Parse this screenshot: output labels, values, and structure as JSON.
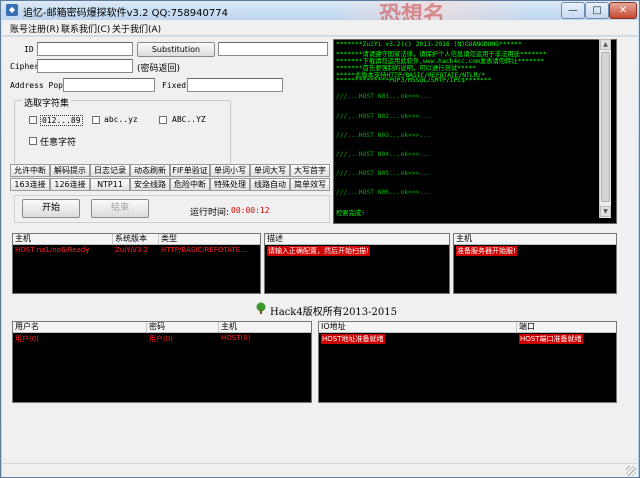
{
  "window": {
    "title": "追忆-邮箱密码爆探软件v3.2  QQ:758940774",
    "deco_text": "恐想名"
  },
  "menu": [
    "账号注册(R)",
    "联系我们(C)",
    "关于我们(A)"
  ],
  "form": {
    "id_label": "ID",
    "id_value": "",
    "substitution_button": "Substitution",
    "substitution_value": "",
    "cipher_label": "Cipher",
    "cipher_value": "",
    "cipher_note": "(密码返回)",
    "address_label": "Address Pop3",
    "address_value": "",
    "fixed_label": "Fixed",
    "fixed_value": ""
  },
  "charset": {
    "legend": "选取字符集",
    "options": [
      {
        "label": "012...89",
        "checked": false
      },
      {
        "label": "abc..yz",
        "checked": false
      },
      {
        "label": "ABC..YZ",
        "checked": false
      },
      {
        "label": "任意字符",
        "checked": false
      }
    ]
  },
  "tools_row1": [
    "允许中断",
    "解码提示",
    "日志记录",
    "动态刷新",
    "FIF单验证",
    "单词小写",
    "单词大写",
    "大写首字"
  ],
  "tools_row2": [
    "163连接",
    "126连接",
    "NTP11",
    "安全线路",
    "危险中断",
    "特殊处理",
    "线路自动",
    "简单效写"
  ],
  "run": {
    "start_button": "开始",
    "stop_button": "结束",
    "time_label": "运行时间:",
    "time_value": "00:00:12"
  },
  "console": {
    "lines": [
      "*******ZuiYi v3.2(c) 2013-2016 (N)GUANGDONG******",
      "*******请请遵守国家法律，请保护个人信息请勿运用于非法用途*******",
      "*******下载请勿运用此软件,www.hack4cc.com发表请勿转让*******",
      "*******首先要强制的说明，可以进行测试*****",
      "*****此版本支持HTTP/BASIC/REFOTATE/NTLM/*",
      "**************POP3/MSSQL/SMTP/IPC$*******",
      "///...HOST N01...ok>>>...",
      "///...HOST N02...ok>>>...",
      "///...HOST N03...ok>>>...",
      "///...HOST N04...ok>>>...",
      "///...HOST N05...ok>>>...",
      "///...HOST N06...ok>>>...",
      "检索完成!"
    ]
  },
  "result_panel": {
    "headers": [
      "主机",
      "系统版本",
      "类型"
    ],
    "row": [
      "HOST no1/no6/Ready",
      "ZuiYiV3.2",
      "HTTP/BASIC/REFOTATE..."
    ]
  },
  "desc_panel": {
    "header": "描述",
    "row": "请输入正确配置，然后开始扫描!"
  },
  "host_panel": {
    "header": "主机",
    "row": "准备服务器开始服!"
  },
  "copyright": "Hack4版权所有2013-2015",
  "account_panel": {
    "headers": [
      "用户名",
      "密码",
      "主机"
    ],
    "row": [
      "用户(0)",
      "用户(0)",
      "HOST(0)"
    ]
  },
  "address_panel": {
    "headers": [
      "IO地址",
      "端口"
    ],
    "row": [
      "HOST地址准备就绪",
      "HOST端口准备就绪"
    ]
  },
  "icons": {
    "minimize": "—",
    "maximize": "□",
    "close": "✕",
    "scroll_up": "▲",
    "scroll_down": "▼"
  },
  "colors": {
    "console_text": "#00ff00",
    "alert_red": "#ff2020",
    "time_red": "#e00000"
  }
}
